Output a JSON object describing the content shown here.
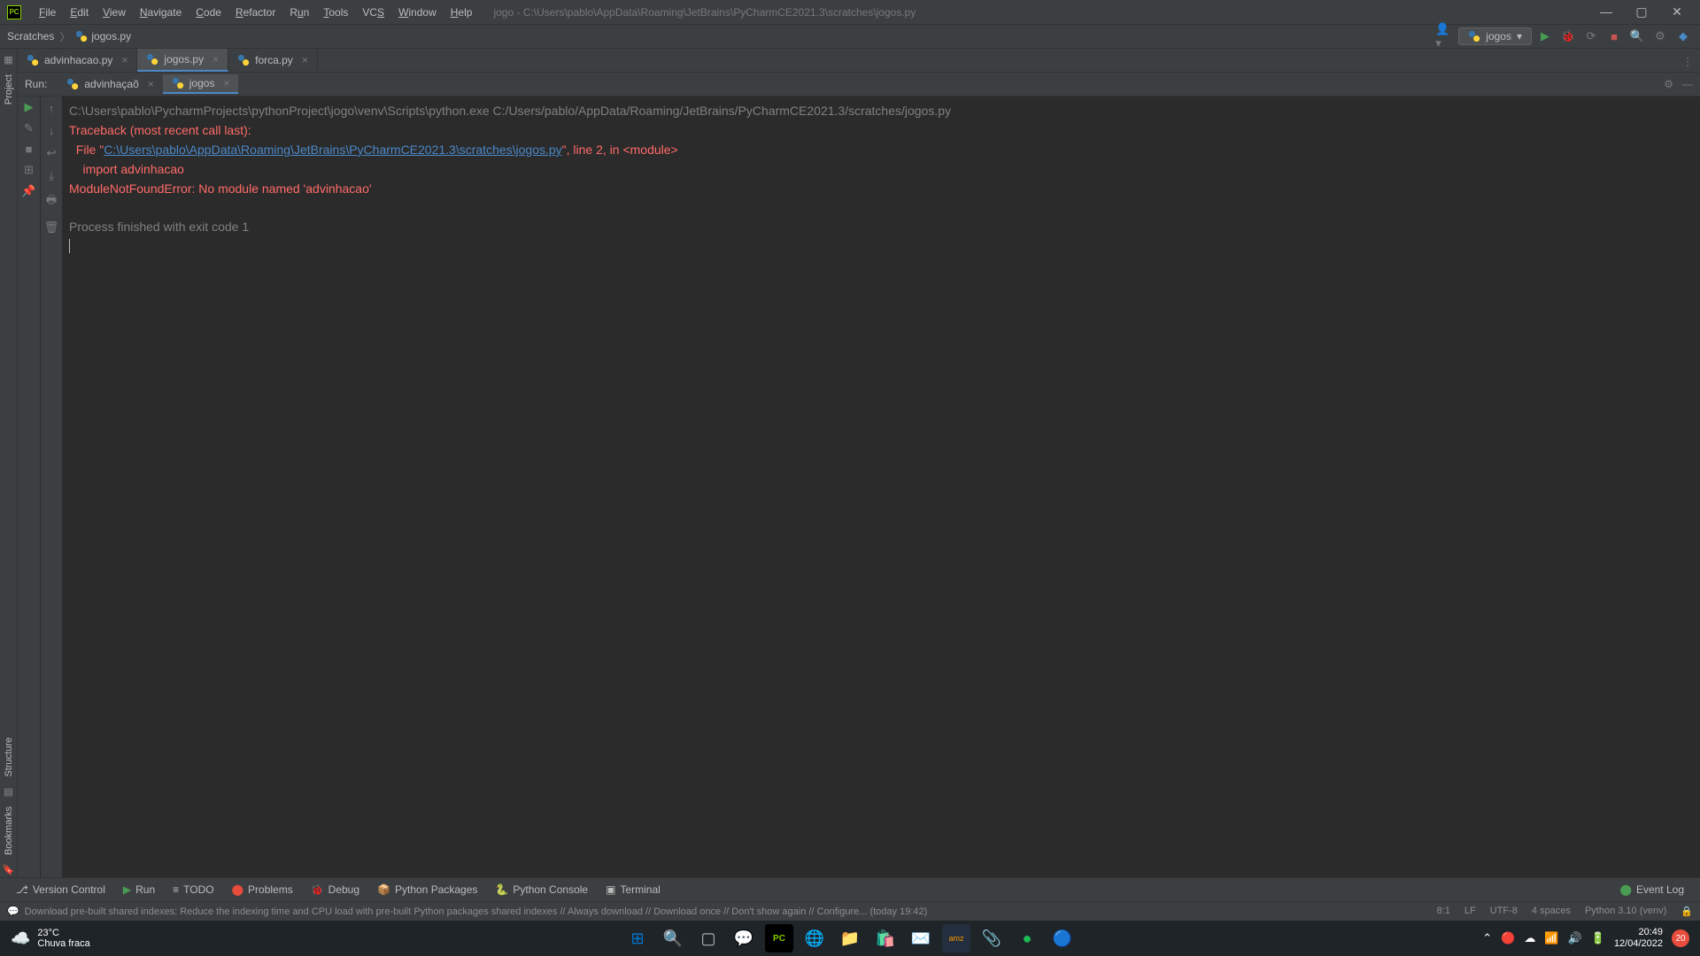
{
  "titlebar": {
    "menus": [
      "File",
      "Edit",
      "View",
      "Navigate",
      "Code",
      "Refactor",
      "Run",
      "Tools",
      "VCS",
      "Window",
      "Help"
    ],
    "path": "jogo - C:\\Users\\pablo\\AppData\\Roaming\\JetBrains\\PyCharmCE2021.3\\scratches\\jogos.py"
  },
  "breadcrumb": {
    "parts": [
      "Scratches",
      "jogos.py"
    ]
  },
  "run_config": {
    "selected": "jogos"
  },
  "editor_tabs": [
    {
      "name": "advinhacao.py",
      "active": false
    },
    {
      "name": "jogos.py",
      "active": true
    },
    {
      "name": "forca.py",
      "active": false
    }
  ],
  "run_panel": {
    "label": "Run:",
    "tabs": [
      {
        "name": "advinhaçaõ",
        "active": false
      },
      {
        "name": "jogos",
        "active": true
      }
    ]
  },
  "console": {
    "cmd": "C:\\Users\\pablo\\PycharmProjects\\pythonProject\\jogo\\venv\\Scripts\\python.exe C:/Users/pablo/AppData/Roaming/JetBrains/PyCharmCE2021.3/scratches/jogos.py",
    "trace_header": "Traceback (most recent call last):",
    "file_prefix": "  File \"",
    "file_link": "C:\\Users\\pablo\\AppData\\Roaming\\JetBrains\\PyCharmCE2021.3\\scratches\\jogos.py",
    "file_suffix": "\", line 2, in <module>",
    "import_line": "    import advinhacao",
    "error_line": "ModuleNotFoundError: No module named 'advinhacao'",
    "exit_line": "Process finished with exit code 1"
  },
  "bottom_tabs": {
    "vcs": "Version Control",
    "run": "Run",
    "todo": "TODO",
    "problems": "Problems",
    "debug": "Debug",
    "pypkg": "Python Packages",
    "pyconsole": "Python Console",
    "terminal": "Terminal",
    "event_log": "Event Log"
  },
  "status_bar": {
    "msg_hint": "Download pre-built shared indexes: Reduce the indexing time and CPU load with pre-built Python packages shared indexes // Always download // Download once // Don't show again // Configure... (today 19:42)",
    "pos": "8:1",
    "sep": "LF",
    "enc": "UTF-8",
    "indent": "4 spaces",
    "interp": "Python 3.10 (venv)"
  },
  "left_sidebar": {
    "project": "Project",
    "structure": "Structure",
    "bookmarks": "Bookmarks"
  },
  "taskbar": {
    "weather_temp": "23°C",
    "weather_desc": "Chuva fraca",
    "time": "20:49",
    "date": "12/04/2022",
    "notif": "20"
  }
}
